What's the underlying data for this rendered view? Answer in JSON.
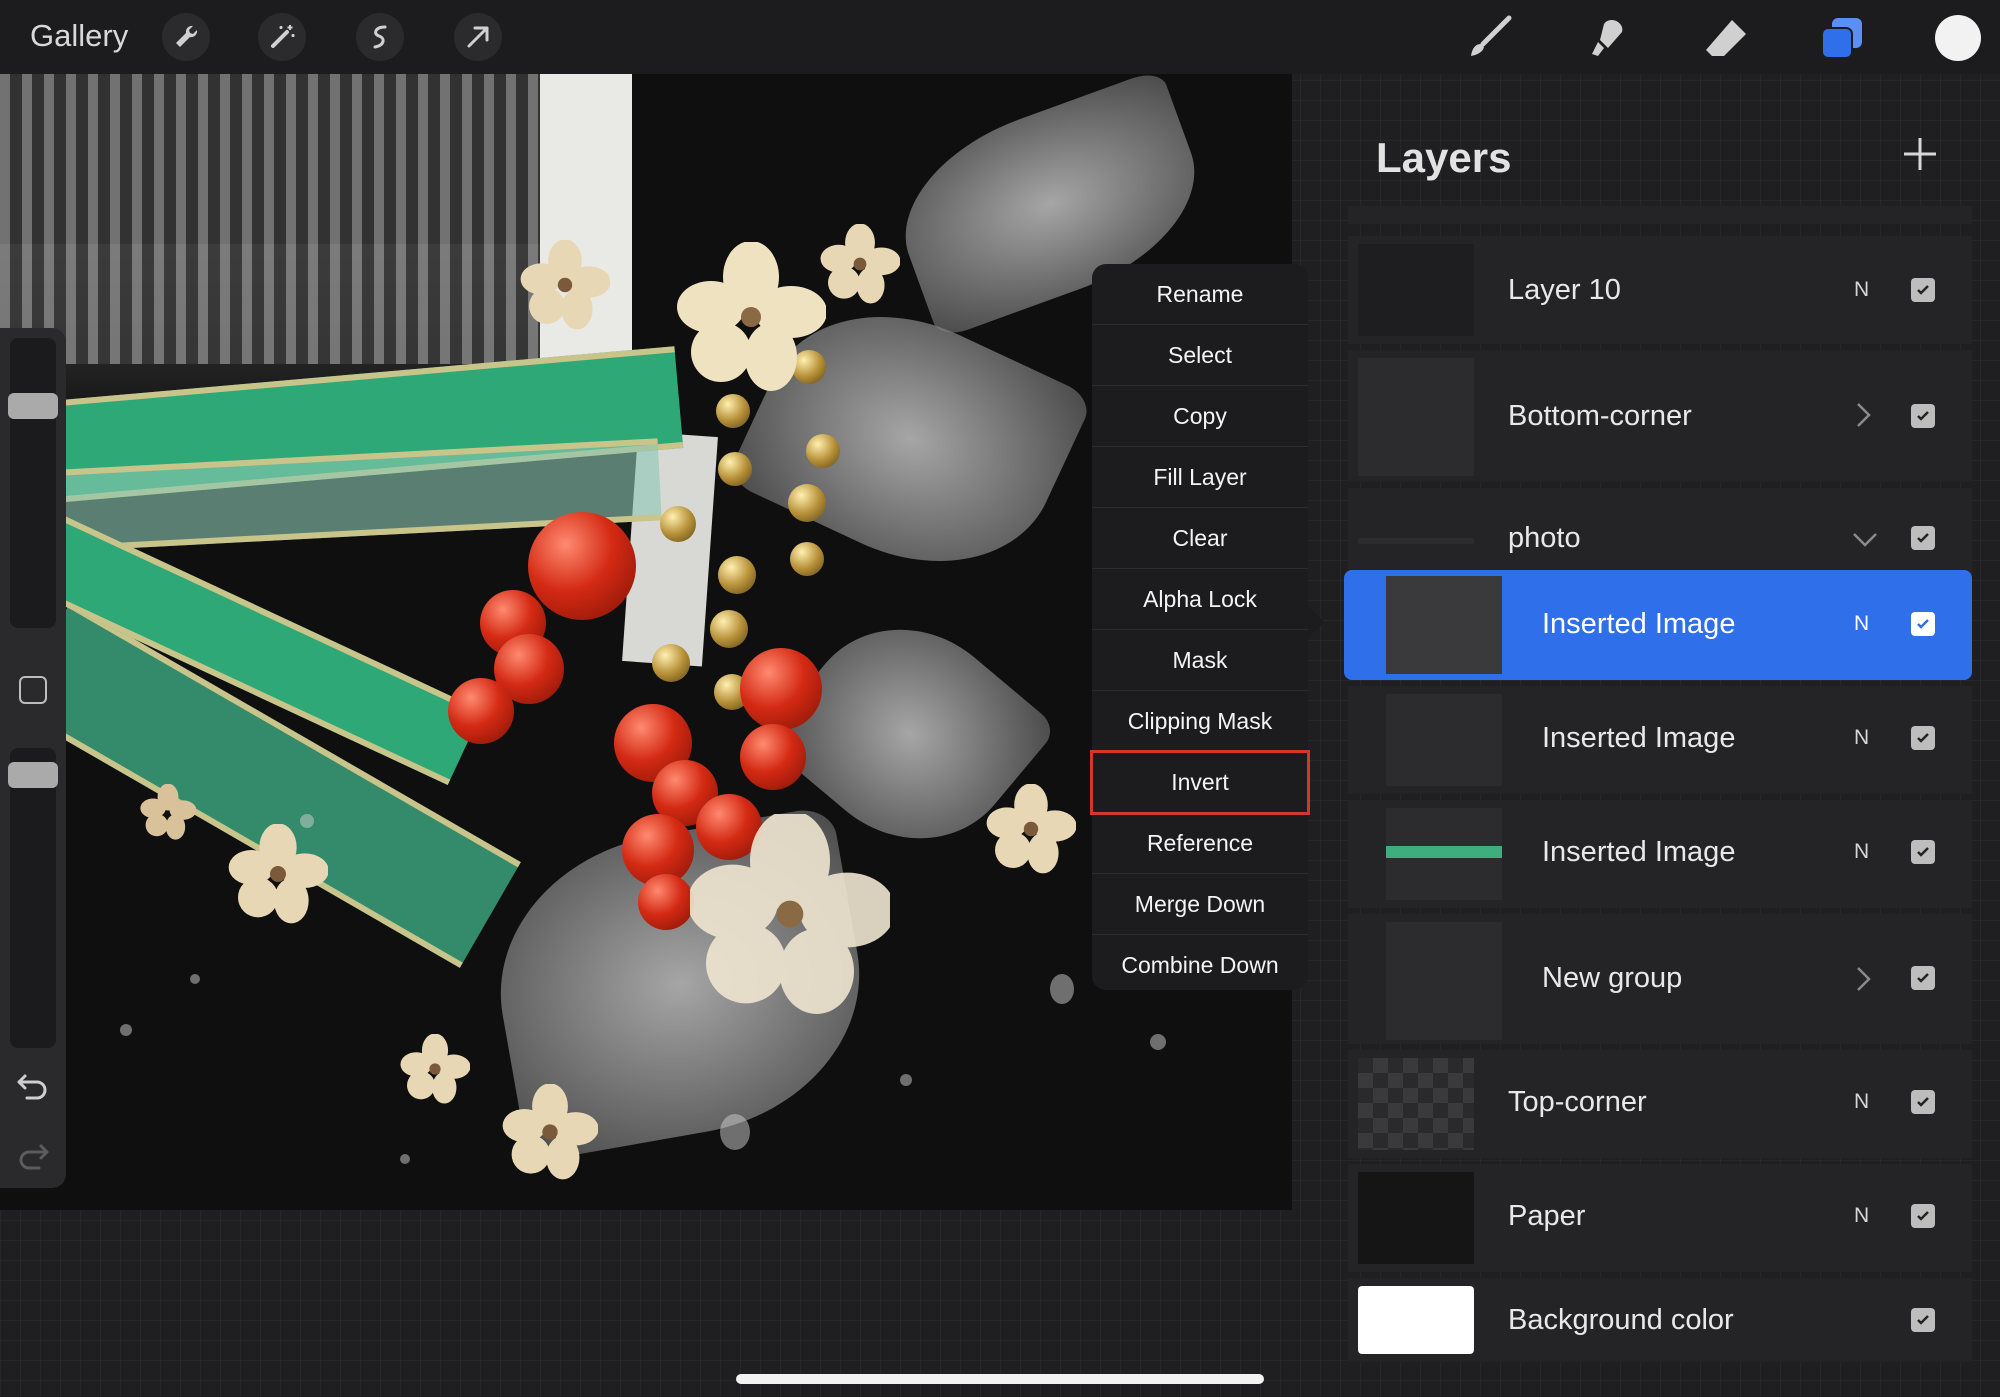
{
  "topbar": {
    "gallery_label": "Gallery",
    "left_tools": [
      "wrench-icon",
      "magic-wand-icon",
      "selection-icon",
      "transform-arrow-icon"
    ],
    "right_tools": [
      "brush-icon",
      "smudge-icon",
      "eraser-icon",
      "layers-icon",
      "color-swatch"
    ],
    "active_tool_color": "#2f6fea"
  },
  "context_menu": {
    "items": [
      "Rename",
      "Select",
      "Copy",
      "Fill Layer",
      "Clear",
      "Alpha Lock",
      "Mask",
      "Clipping Mask",
      "Invert",
      "Reference",
      "Merge Down",
      "Combine Down"
    ],
    "highlighted": "Invert",
    "highlight_color": "#d4362c"
  },
  "layers": {
    "title": "Layers",
    "add_icon": "plus-icon",
    "rows": [
      {
        "name": "Layer 10",
        "blend": "N",
        "visible": true,
        "type": "layer"
      },
      {
        "name": "Bottom-corner",
        "blend": "",
        "visible": true,
        "type": "group-collapsed"
      },
      {
        "name": "photo",
        "blend": "",
        "visible": true,
        "type": "group-expanded"
      },
      {
        "name": "Inserted Image",
        "blend": "N",
        "visible": true,
        "type": "layer",
        "selected": true
      },
      {
        "name": "Inserted Image",
        "blend": "N",
        "visible": true,
        "type": "layer"
      },
      {
        "name": "Inserted Image",
        "blend": "N",
        "visible": true,
        "type": "layer"
      },
      {
        "name": "New group",
        "blend": "",
        "visible": true,
        "type": "group-collapsed"
      },
      {
        "name": "Top-corner",
        "blend": "N",
        "visible": true,
        "type": "layer"
      },
      {
        "name": "Paper",
        "blend": "N",
        "visible": true,
        "type": "layer"
      },
      {
        "name": "Background color",
        "blend": "",
        "visible": true,
        "type": "background"
      }
    ],
    "selected_color": "#2f6fea"
  }
}
